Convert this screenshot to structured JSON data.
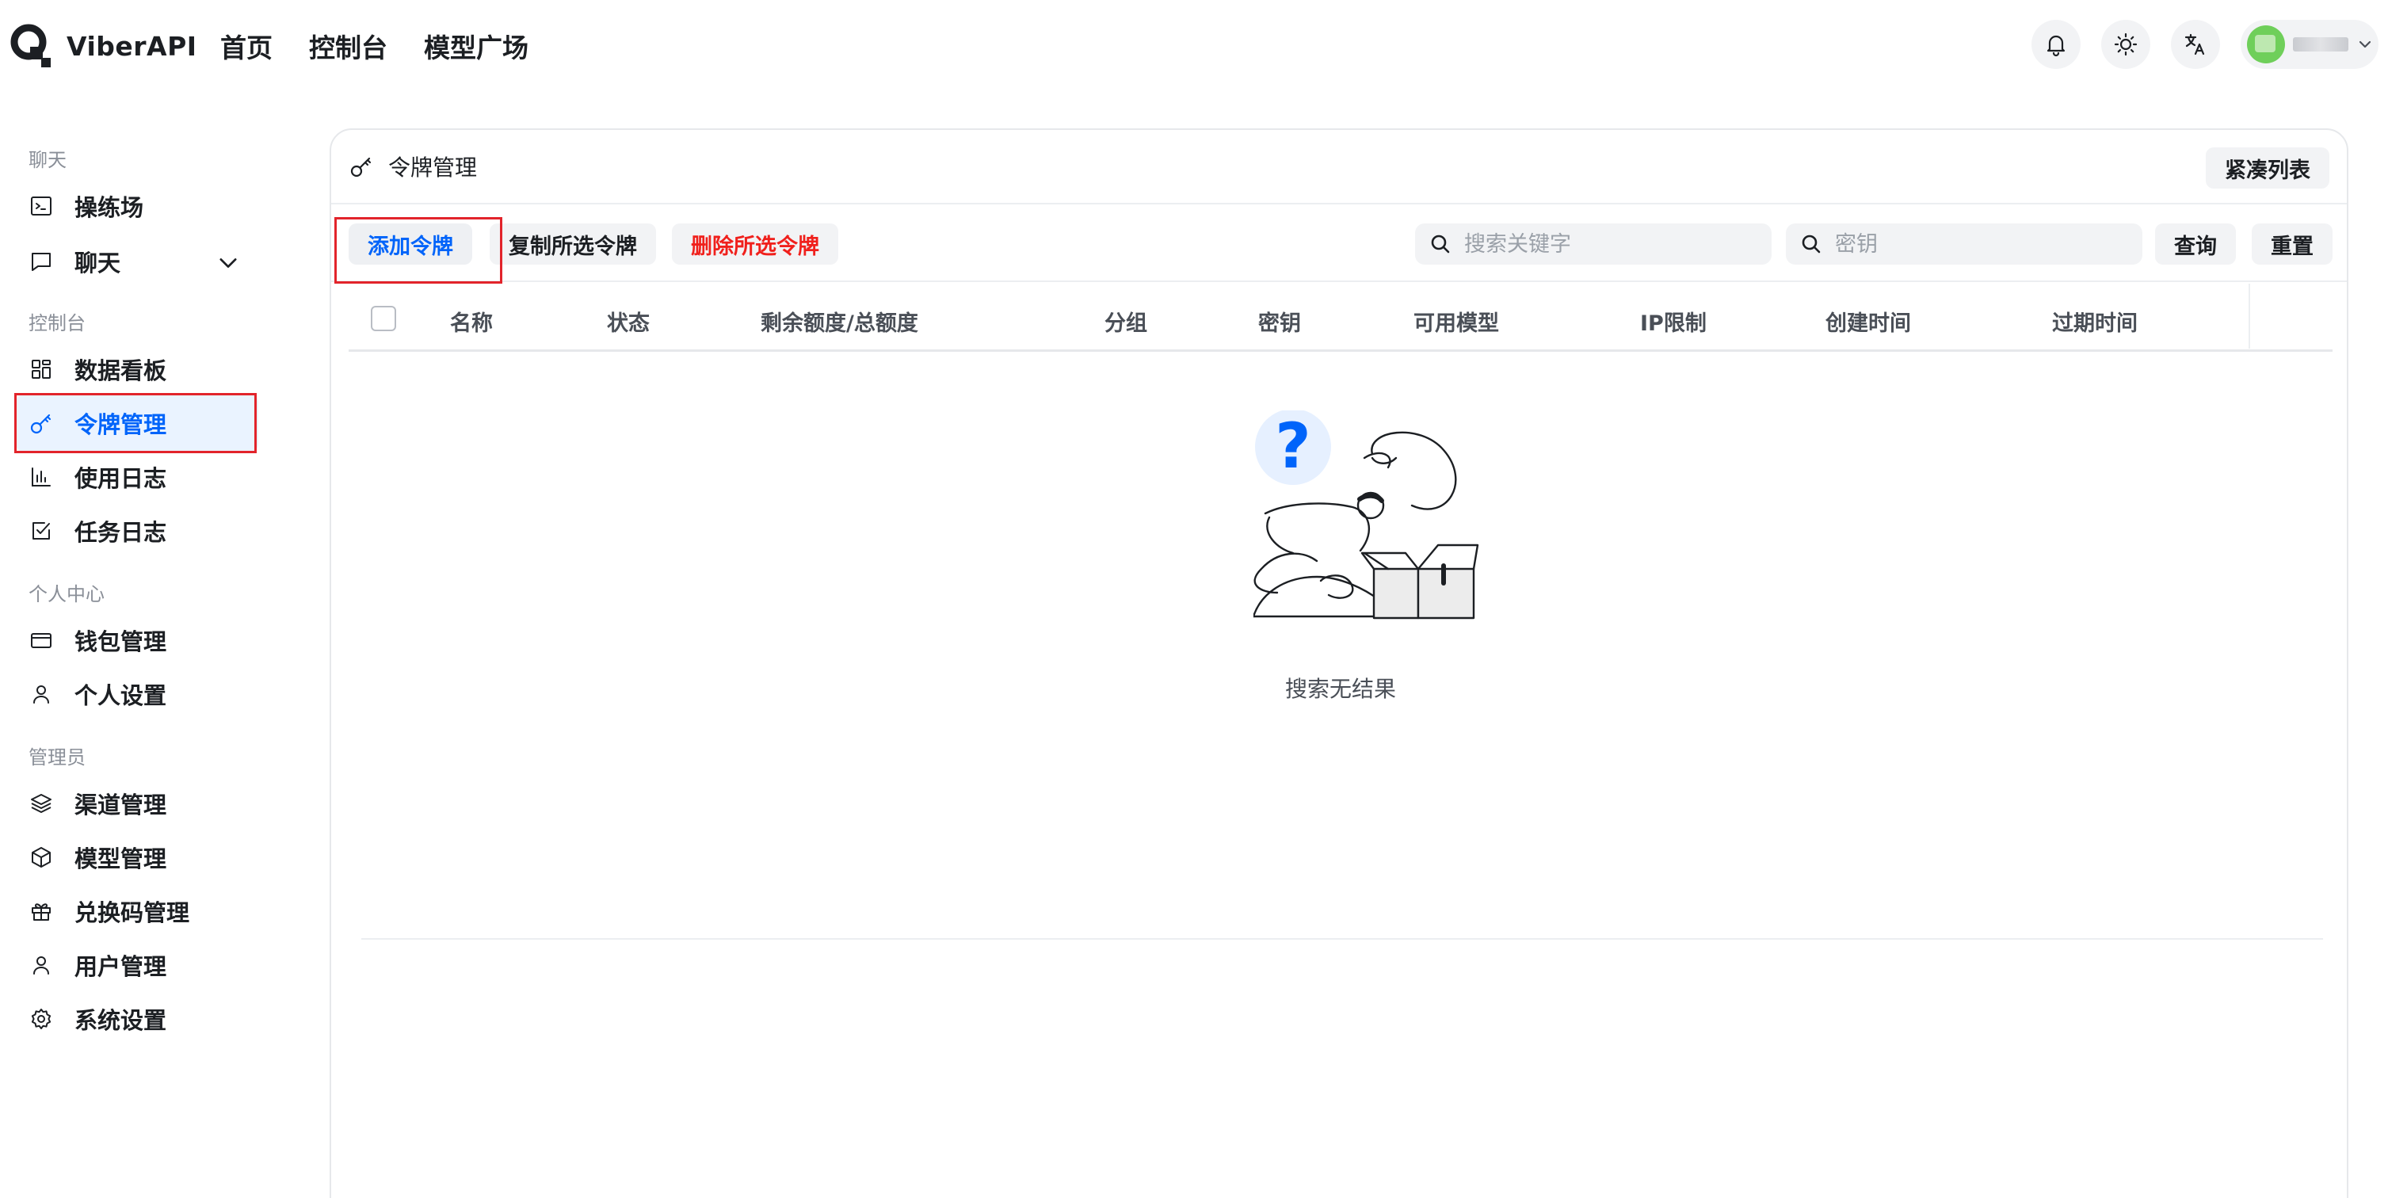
{
  "app": {
    "name": "ViberAPI"
  },
  "nav": {
    "items": [
      "首页",
      "控制台",
      "模型广场"
    ]
  },
  "sidebar": {
    "groups": [
      {
        "title": "聊天",
        "items": [
          {
            "label": "操练场",
            "icon": "terminal-icon"
          },
          {
            "label": "聊天",
            "icon": "message-icon"
          }
        ]
      },
      {
        "title": "控制台",
        "items": [
          {
            "label": "数据看板",
            "icon": "dashboard-icon"
          },
          {
            "label": "令牌管理",
            "icon": "key-icon"
          },
          {
            "label": "使用日志",
            "icon": "bar-chart-icon"
          },
          {
            "label": "任务日志",
            "icon": "checkbox-icon"
          }
        ]
      },
      {
        "title": "个人中心",
        "items": [
          {
            "label": "钱包管理",
            "icon": "card-icon"
          },
          {
            "label": "个人设置",
            "icon": "user-icon"
          }
        ]
      },
      {
        "title": "管理员",
        "items": [
          {
            "label": "渠道管理",
            "icon": "layers-icon"
          },
          {
            "label": "模型管理",
            "icon": "cube-icon"
          },
          {
            "label": "兑换码管理",
            "icon": "gift-icon"
          },
          {
            "label": "用户管理",
            "icon": "user-icon"
          },
          {
            "label": "系统设置",
            "icon": "gear-icon"
          }
        ]
      }
    ]
  },
  "card": {
    "title": "令牌管理",
    "compact_label": "紧凑列表"
  },
  "toolbar": {
    "add_label": "添加令牌",
    "copy_label": "复制所选令牌",
    "delete_label": "删除所选令牌",
    "search_keyword_placeholder": "搜索关键字",
    "search_key_placeholder": "密钥",
    "query_label": "查询",
    "reset_label": "重置"
  },
  "table": {
    "columns": [
      "名称",
      "状态",
      "剩余额度/总额度",
      "分组",
      "密钥",
      "可用模型",
      "IP限制",
      "创建时间",
      "过期时间"
    ],
    "empty_text": "搜索无结果"
  },
  "colors": {
    "accent": "#0064fa",
    "danger": "#f0201c",
    "highlight": "#e2242b",
    "active_bg": "#eaf3ff"
  }
}
